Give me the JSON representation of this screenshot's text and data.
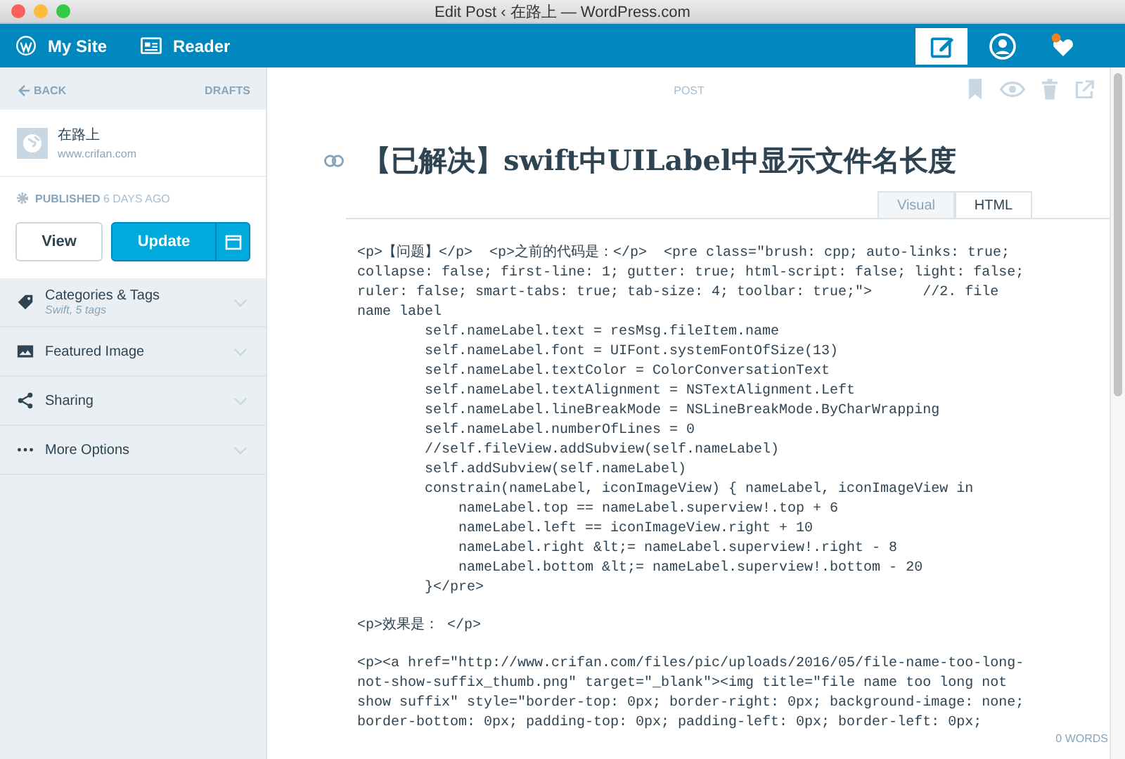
{
  "window": {
    "title": "Edit Post ‹ 在路上 — WordPress.com"
  },
  "masterbar": {
    "items": [
      {
        "kind": "mysite",
        "label": "My Site"
      },
      {
        "kind": "reader",
        "label": "Reader"
      }
    ],
    "actions": [
      {
        "kind": "write",
        "selected": true
      },
      {
        "kind": "profile",
        "selected": false
      },
      {
        "kind": "notifications",
        "selected": false,
        "unread": true
      }
    ]
  },
  "sidebar": {
    "back": "BACK",
    "drafts": "DRAFTS",
    "site": {
      "name": "在路上",
      "url": "www.crifan.com"
    },
    "status": {
      "label": "PUBLISHED",
      "time": "6 DAYS AGO"
    },
    "buttons": {
      "view": "View",
      "update": "Update"
    },
    "sections": [
      {
        "kind": "tags",
        "title": "Categories & Tags",
        "subtitle": "Swift, 5 tags",
        "expanded": false
      },
      {
        "kind": "image",
        "title": "Featured Image",
        "expanded": false
      },
      {
        "kind": "share",
        "title": "Sharing",
        "expanded": false
      },
      {
        "kind": "more",
        "title": "More Options",
        "expanded": false
      }
    ]
  },
  "editor": {
    "heading": "POST",
    "title": "【已解决】swift中UILabel中显示文件名长度",
    "tabs": [
      {
        "label": "Visual",
        "selected": false
      },
      {
        "label": "HTML",
        "selected": true
      }
    ],
    "blocks": [
      [
        "<p>【问题】</p>  <p>之前的代码是：</p>  <pre class=\"brush: cpp; auto-links: true;",
        "collapse: false; first-line: 1; gutter: true; html-script: false; light: false;",
        "ruler: false; smart-tabs: true; tab-size: 4; toolbar: true;\">      //2. file",
        "name label",
        "        self.nameLabel.text = resMsg.fileItem.name",
        "        self.nameLabel.font = UIFont.systemFontOfSize(13)",
        "        self.nameLabel.textColor = ColorConversationText",
        "        self.nameLabel.textAlignment = NSTextAlignment.Left",
        "        self.nameLabel.lineBreakMode = NSLineBreakMode.ByCharWrapping",
        "        self.nameLabel.numberOfLines = 0",
        "        //self.fileView.addSubview(self.nameLabel)",
        "        self.addSubview(self.nameLabel)",
        "        constrain(nameLabel, iconImageView) { nameLabel, iconImageView in",
        "            nameLabel.top == nameLabel.superview!.top + 6",
        "            nameLabel.left == iconImageView.right + 10",
        "            nameLabel.right &lt;= nameLabel.superview!.right - 8",
        "            nameLabel.bottom &lt;= nameLabel.superview!.bottom - 20",
        "        }</pre>"
      ],
      [
        "<p>效果是： </p>"
      ],
      [
        "<p><a href=\"http://www.crifan.com/files/pic/uploads/2016/05/file-name-too-long-",
        "not-show-suffix_thumb.png\" target=\"_blank\"><img title=\"file name too long not",
        "show suffix\" style=\"border-top: 0px; border-right: 0px; background-image: none;",
        "border-bottom: 0px; padding-top: 0px; padding-left: 0px; border-left: 0px;"
      ]
    ],
    "word_count": "0 WORDS"
  }
}
